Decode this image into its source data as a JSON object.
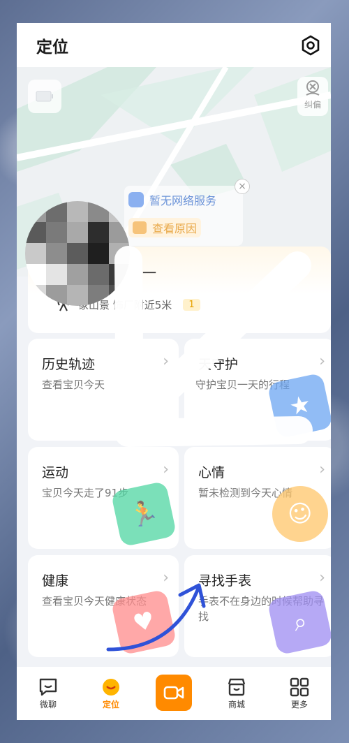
{
  "header": {
    "title": "定位"
  },
  "map": {
    "fix_label": "纠偏",
    "no_network": "暂无网络服务",
    "view_reason": "查看原因",
    "close_symbol": "×"
  },
  "location_card": {
    "name_fragment": "一",
    "address": "象山景  饰厂附近5米",
    "badge": "1"
  },
  "cards": [
    {
      "title": "历史轨迹",
      "sub": "查看宝贝今天",
      "arrow": "›"
    },
    {
      "title": "  天守护",
      "sub": "守护宝贝一天的行程",
      "arrow": "›"
    },
    {
      "title": "运动",
      "sub": "宝贝今天走了91步",
      "arrow": "›"
    },
    {
      "title": "心情",
      "sub": "暂未检测到今天心情",
      "arrow": "›"
    },
    {
      "title": "健康",
      "sub": "查看宝贝今天健康状态",
      "arrow": "›"
    },
    {
      "title": "寻找手表",
      "sub": "手表不在身边的时候帮助寻找",
      "arrow": "›"
    }
  ],
  "nav": [
    {
      "label": "微聊"
    },
    {
      "label": "定位"
    },
    {
      "label": ""
    },
    {
      "label": "商城"
    },
    {
      "label": "更多"
    }
  ],
  "colors": {
    "accent": "#ff8a00",
    "active_label": "#ff8a00"
  }
}
